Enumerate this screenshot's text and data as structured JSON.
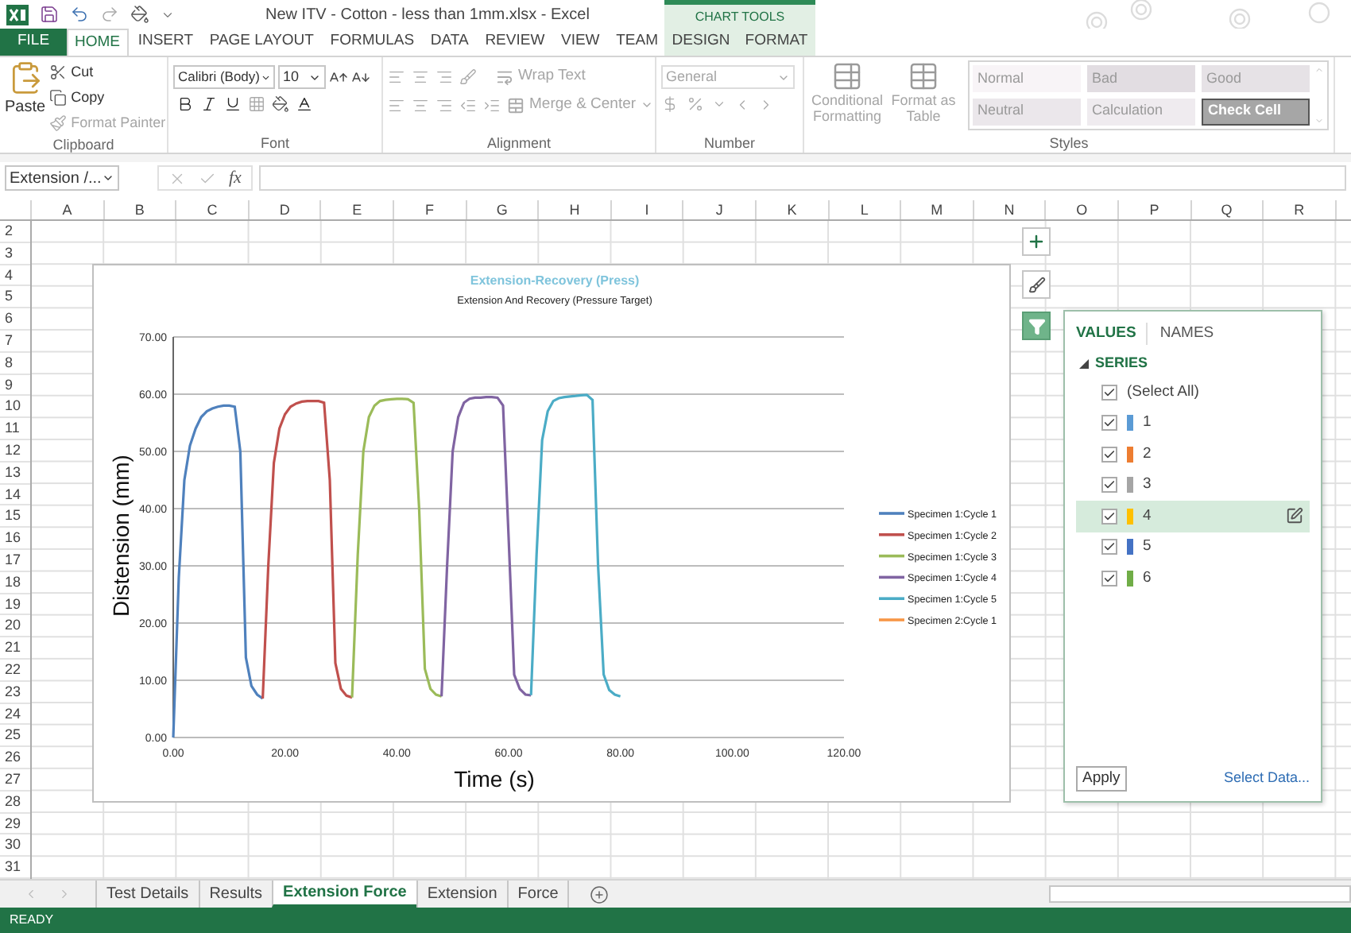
{
  "title_bar": {
    "title": "New ITV - Cotton - less than 1mm.xlsx - Excel",
    "context_label": "CHART TOOLS"
  },
  "ribbon_tabs": [
    {
      "label": "FILE",
      "kind": "file",
      "selected": false
    },
    {
      "label": "HOME",
      "kind": "tab",
      "selected": true
    },
    {
      "label": "INSERT",
      "kind": "tab",
      "selected": false
    },
    {
      "label": "PAGE LAYOUT",
      "kind": "tab",
      "selected": false
    },
    {
      "label": "FORMULAS",
      "kind": "tab",
      "selected": false
    },
    {
      "label": "DATA",
      "kind": "tab",
      "selected": false
    },
    {
      "label": "REVIEW",
      "kind": "tab",
      "selected": false
    },
    {
      "label": "VIEW",
      "kind": "tab",
      "selected": false
    },
    {
      "label": "TEAM",
      "kind": "tab",
      "selected": false
    },
    {
      "label": "DESIGN",
      "kind": "context",
      "selected": false
    },
    {
      "label": "FORMAT",
      "kind": "context",
      "selected": false
    }
  ],
  "clipboard": {
    "paste": "Paste",
    "items": [
      {
        "label": "Cut",
        "kind": "cut",
        "disabled": false
      },
      {
        "label": "Copy",
        "kind": "copy",
        "disabled": false
      },
      {
        "label": "Format Painter",
        "kind": "painter",
        "disabled": true
      }
    ],
    "label": "Clipboard"
  },
  "font": {
    "name": "Calibri (Body)",
    "size": "10",
    "label": "Font"
  },
  "alignment": {
    "wrap": {
      "label": "Wrap Text",
      "disabled": true
    },
    "merge": {
      "label": "Merge & Center",
      "disabled": true
    },
    "label": "Alignment"
  },
  "number": {
    "format": {
      "value": "General",
      "disabled": true
    },
    "label": "Number"
  },
  "styles": {
    "buttons": [
      {
        "label": "Conditional Formatting",
        "kind": "conditional",
        "disabled": true
      },
      {
        "label": "Format as Table",
        "kind": "table",
        "disabled": true
      }
    ],
    "cells": [
      {
        "label": "Normal",
        "color": "#f8f4f7"
      },
      {
        "label": "Bad",
        "color": "#e2dde2"
      },
      {
        "label": "Good",
        "color": "#e6e2e6"
      },
      {
        "label": "Neutral",
        "color": "#ebe7eb"
      },
      {
        "label": "Calculation",
        "color": "#efebef"
      },
      {
        "label": "Check Cell",
        "color": "#a6a6a6"
      }
    ],
    "label": "Styles"
  },
  "name_box": "Extension /...",
  "formula_bar": {
    "fx": "fx"
  },
  "columns": [
    "A",
    "B",
    "C",
    "D",
    "E",
    "F",
    "G",
    "H",
    "I",
    "J",
    "K",
    "L",
    "M",
    "N",
    "O",
    "P",
    "Q",
    "R"
  ],
  "rows": [
    "2",
    "3",
    "4",
    "5",
    "6",
    "7",
    "8",
    "9",
    "10",
    "11",
    "12",
    "13",
    "14",
    "15",
    "16",
    "17",
    "18",
    "19",
    "20",
    "21",
    "22",
    "23",
    "24",
    "25",
    "26",
    "27",
    "28",
    "29",
    "30",
    "31"
  ],
  "chart": {
    "subtitle": "Extension And Recovery (Pressure Target)",
    "chart_data": {
      "type": "line",
      "title": "Extension-Recovery (Press)",
      "xlabel": "Time (s)",
      "ylabel": "Distension (mm)",
      "x": [
        0,
        1,
        2,
        3,
        4,
        5,
        6,
        7,
        8,
        9,
        10,
        11,
        12,
        13,
        14,
        15,
        16,
        17,
        18,
        19,
        20,
        21,
        22,
        23,
        24,
        25,
        26,
        27,
        28,
        29,
        30,
        31,
        32,
        33,
        34,
        35,
        36,
        37,
        38,
        39,
        40,
        41,
        42,
        43,
        44,
        45,
        46,
        47,
        48,
        49,
        50,
        51,
        52,
        53,
        54,
        55,
        56,
        57,
        58,
        59,
        60,
        61,
        62,
        63,
        64,
        65,
        66,
        67,
        68,
        69,
        70,
        71,
        72,
        73,
        74,
        75,
        76,
        77,
        78,
        79,
        80
      ],
      "series": [
        {
          "name": "Specimen 1:Cycle 1",
          "color": "#4f81bd",
          "values": [
            0,
            28,
            45,
            51,
            54,
            56,
            57,
            57.5,
            57.8,
            58,
            58,
            57.8,
            50,
            14,
            9,
            7.5,
            6.8,
            null,
            null,
            null,
            null,
            null,
            null,
            null,
            null,
            null,
            null,
            null,
            null,
            null,
            null,
            null,
            null,
            null,
            null,
            null,
            null,
            null,
            null,
            null,
            null,
            null,
            null,
            null,
            null,
            null,
            null,
            null,
            null,
            null,
            null,
            null,
            null,
            null,
            null,
            null,
            null,
            null,
            null,
            null,
            null,
            null,
            null,
            null,
            null,
            null,
            null,
            null,
            null,
            null,
            null,
            null,
            null,
            null,
            null,
            null,
            null,
            null,
            null,
            null,
            null
          ]
        },
        {
          "name": "Specimen 1:Cycle 2",
          "color": "#c0504d",
          "values": [
            null,
            null,
            null,
            null,
            null,
            null,
            null,
            null,
            null,
            null,
            null,
            null,
            null,
            null,
            null,
            null,
            6.8,
            30,
            48,
            54,
            56.5,
            57.8,
            58.4,
            58.7,
            58.8,
            58.8,
            58.8,
            58.5,
            45,
            13,
            8.5,
            7.3,
            7,
            null,
            null,
            null,
            null,
            null,
            null,
            null,
            null,
            null,
            null,
            null,
            null,
            null,
            null,
            null,
            null,
            null,
            null,
            null,
            null,
            null,
            null,
            null,
            null,
            null,
            null,
            null,
            null,
            null,
            null,
            null,
            null,
            null,
            null,
            null,
            null,
            null,
            null,
            null,
            null,
            null,
            null,
            null,
            null,
            null,
            null,
            null,
            null
          ]
        },
        {
          "name": "Specimen 1:Cycle 3",
          "color": "#9bbb59",
          "values": [
            null,
            null,
            null,
            null,
            null,
            null,
            null,
            null,
            null,
            null,
            null,
            null,
            null,
            null,
            null,
            null,
            null,
            null,
            null,
            null,
            null,
            null,
            null,
            null,
            null,
            null,
            null,
            null,
            null,
            null,
            null,
            null,
            7,
            32,
            50,
            56,
            58,
            58.8,
            59,
            59.1,
            59.2,
            59.2,
            59.1,
            58.5,
            40,
            12,
            8.5,
            7.5,
            7.2,
            null,
            null,
            null,
            null,
            null,
            null,
            null,
            null,
            null,
            null,
            null,
            null,
            null,
            null,
            null,
            null,
            null,
            null,
            null,
            null,
            null,
            null,
            null,
            null,
            null,
            null,
            null,
            null,
            null,
            null,
            null,
            null
          ]
        },
        {
          "name": "Specimen 1:Cycle 4",
          "color": "#8064a2",
          "values": [
            null,
            null,
            null,
            null,
            null,
            null,
            null,
            null,
            null,
            null,
            null,
            null,
            null,
            null,
            null,
            null,
            null,
            null,
            null,
            null,
            null,
            null,
            null,
            null,
            null,
            null,
            null,
            null,
            null,
            null,
            null,
            null,
            null,
            null,
            null,
            null,
            null,
            null,
            null,
            null,
            null,
            null,
            null,
            null,
            null,
            null,
            null,
            null,
            7.2,
            30,
            50,
            56,
            58.5,
            59.2,
            59.4,
            59.4,
            59.5,
            59.5,
            59.4,
            58,
            35,
            11,
            8.5,
            7.5,
            7.4,
            null,
            null,
            null,
            null,
            null,
            null,
            null,
            null,
            null,
            null,
            null,
            null,
            null,
            null,
            null,
            null
          ]
        },
        {
          "name": "Specimen 1:Cycle 5",
          "color": "#4bacc6",
          "values": [
            null,
            null,
            null,
            null,
            null,
            null,
            null,
            null,
            null,
            null,
            null,
            null,
            null,
            null,
            null,
            null,
            null,
            null,
            null,
            null,
            null,
            null,
            null,
            null,
            null,
            null,
            null,
            null,
            null,
            null,
            null,
            null,
            null,
            null,
            null,
            null,
            null,
            null,
            null,
            null,
            null,
            null,
            null,
            null,
            null,
            null,
            null,
            null,
            null,
            null,
            null,
            null,
            null,
            null,
            null,
            null,
            null,
            null,
            null,
            null,
            null,
            null,
            null,
            null,
            7.4,
            32,
            52,
            57,
            58.8,
            59.3,
            59.5,
            59.6,
            59.7,
            59.8,
            59.9,
            59,
            30,
            11,
            8.3,
            7.5,
            7.2
          ]
        },
        {
          "name": "Specimen 2:Cycle 1",
          "color": "#f79646",
          "values": [
            null,
            null,
            null,
            null,
            null,
            null,
            null,
            null,
            null,
            null,
            null,
            null,
            null,
            null,
            null,
            null,
            null,
            null,
            null,
            null,
            null,
            null,
            null,
            null,
            null,
            null,
            null,
            null,
            null,
            null,
            null,
            null,
            null,
            null,
            null,
            null,
            null,
            null,
            null,
            null,
            null,
            null,
            null,
            null,
            null,
            null,
            null,
            null,
            null,
            null,
            null,
            null,
            null,
            null,
            null,
            null,
            null,
            null,
            null,
            null,
            null,
            null,
            null,
            null,
            null,
            null,
            null,
            null,
            null,
            null,
            null,
            null,
            null,
            null,
            null,
            null,
            null,
            null,
            null,
            null,
            null
          ]
        }
      ],
      "xlim": [
        0,
        120
      ],
      "ylim": [
        0,
        70
      ],
      "grid": "y",
      "legend": "right",
      "xticks": [
        {
          "value": 0,
          "label": "0.00"
        },
        {
          "value": 20,
          "label": "20.00"
        },
        {
          "value": 40,
          "label": "40.00"
        },
        {
          "value": 60,
          "label": "60.00"
        },
        {
          "value": 80,
          "label": "80.00"
        },
        {
          "value": 100,
          "label": "100.00"
        },
        {
          "value": 120,
          "label": "120.00"
        }
      ],
      "yticks": [
        {
          "value": 0,
          "label": "0.00"
        },
        {
          "value": 10,
          "label": "10.00"
        },
        {
          "value": 20,
          "label": "20.00"
        },
        {
          "value": 30,
          "label": "30.00"
        },
        {
          "value": 40,
          "label": "40.00"
        },
        {
          "value": 50,
          "label": "50.00"
        },
        {
          "value": 60,
          "label": "60.00"
        },
        {
          "value": 70,
          "label": "70.00"
        }
      ]
    }
  },
  "chart_buttons": [
    {
      "kind": "add",
      "selected": false
    },
    {
      "kind": "style",
      "selected": false
    },
    {
      "kind": "filter",
      "selected": true
    }
  ],
  "filter_panel": {
    "tabs": [
      {
        "label": "VALUES",
        "selected": true
      },
      {
        "label": "NAMES",
        "selected": false
      }
    ],
    "group": {
      "label": "SERIES",
      "expanded": true
    },
    "items": [
      {
        "label": "(Select All)",
        "checked": true,
        "selected": false
      },
      {
        "label": "1",
        "color": "#5b9bd5",
        "checked": true,
        "selected": false
      },
      {
        "label": "2",
        "color": "#ed7d31",
        "checked": true,
        "selected": false
      },
      {
        "label": "3",
        "color": "#a5a5a5",
        "checked": true,
        "selected": false
      },
      {
        "label": "4",
        "color": "#ffc000",
        "checked": true,
        "selected": true
      },
      {
        "label": "5",
        "color": "#4472c4",
        "checked": true,
        "selected": false
      },
      {
        "label": "6",
        "color": "#70ad47",
        "checked": true,
        "selected": false
      }
    ],
    "apply": "Apply",
    "select_data": "Select Data..."
  },
  "sheet_tabs": [
    {
      "label": "Test Details",
      "selected": false
    },
    {
      "label": "Results",
      "selected": false
    },
    {
      "label": "Extension Force",
      "selected": true
    },
    {
      "label": "Extension",
      "selected": false
    },
    {
      "label": "Force",
      "selected": false
    }
  ],
  "status": "READY"
}
